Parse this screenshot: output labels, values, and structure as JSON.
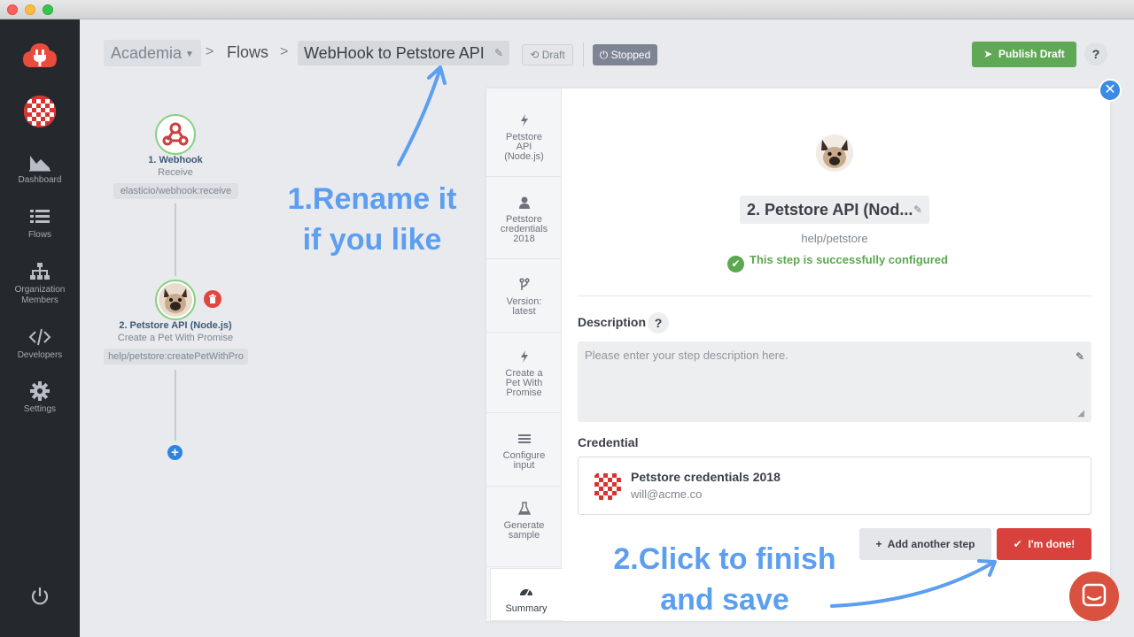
{
  "window": {
    "title": ""
  },
  "sidebar": {
    "items": [
      {
        "label": "Dashboard",
        "icon": "dashboard-icon"
      },
      {
        "label": "Flows",
        "icon": "list-icon"
      },
      {
        "label": "Organization Members",
        "icon": "org-members-icon"
      },
      {
        "label": "Developers",
        "icon": "code-icon"
      },
      {
        "label": "Settings",
        "icon": "gear-icon"
      }
    ]
  },
  "header": {
    "org": "Academia",
    "flows": "Flows",
    "flow_name": "WebHook to Petstore API",
    "draft_label": "Draft",
    "stopped_label": "Stopped",
    "publish_label": "Publish Draft",
    "help": "?"
  },
  "flow": {
    "step1": {
      "title": "1. Webhook",
      "sub": "Receive",
      "tag": "elasticio/webhook:receive"
    },
    "step2": {
      "title": "2. Petstore API (Node.js)",
      "sub": "Create a Pet With Promise",
      "tag": "help/petstore:createPetWithPro"
    }
  },
  "annotations": {
    "rename": "1.Rename it\nif you like",
    "finish": "2.Click to finish\nand save"
  },
  "panel": {
    "tabs": [
      {
        "label": "Petstore API (Node.js)",
        "icon": "bolt-icon"
      },
      {
        "label": "Petstore credentials 2018",
        "icon": "user-icon"
      },
      {
        "label": "Version: latest",
        "icon": "branch-icon"
      },
      {
        "label": "Create a Pet With Promise",
        "icon": "bolt-icon"
      },
      {
        "label": "Configure input",
        "icon": "menu-icon"
      },
      {
        "label": "Generate sample",
        "icon": "flask-icon"
      },
      {
        "label": "Summary",
        "icon": "gauge-icon"
      }
    ],
    "step_name": "2. Petstore API (Nod...",
    "step_path": "help/petstore",
    "status": "This step is successfully configured",
    "description_label": "Description",
    "description_placeholder": "Please enter your step description here.",
    "credential_label": "Credential",
    "credential_name": "Petstore credentials 2018",
    "credential_email": "will@acme.co",
    "add_step_label": "Add another step",
    "done_label": "I'm done!",
    "help": "?"
  },
  "colors": {
    "accent": "#3a8ae6",
    "success": "#5aa84f",
    "danger": "#d9413c",
    "annotation": "#5c9ef0",
    "sidebar": "#25282c"
  }
}
